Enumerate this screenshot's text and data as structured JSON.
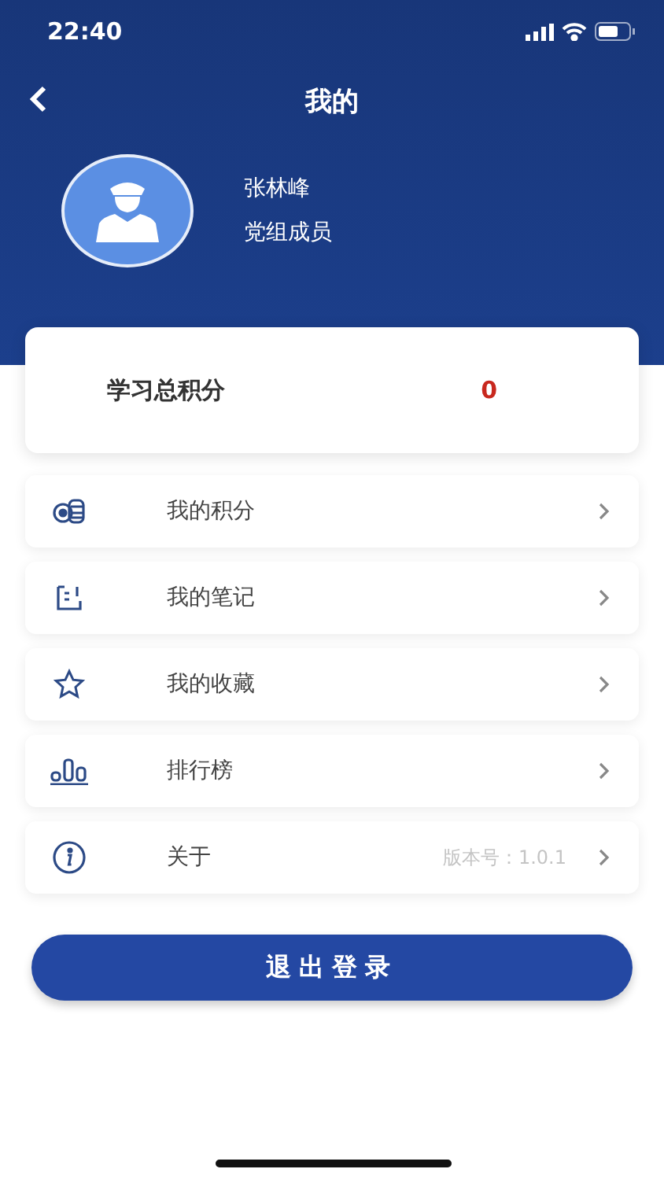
{
  "status_bar": {
    "time": "22:40"
  },
  "header": {
    "title": "我的"
  },
  "profile": {
    "name": "张林峰",
    "role": "党组成员"
  },
  "score": {
    "label": "学习总积分",
    "value": "0"
  },
  "menu": [
    {
      "label": "我的积分"
    },
    {
      "label": "我的笔记"
    },
    {
      "label": "我的收藏"
    },
    {
      "label": "排行榜"
    },
    {
      "label": "关于",
      "note": "版本号：1.0.1"
    }
  ],
  "logout_button": "退出登录"
}
